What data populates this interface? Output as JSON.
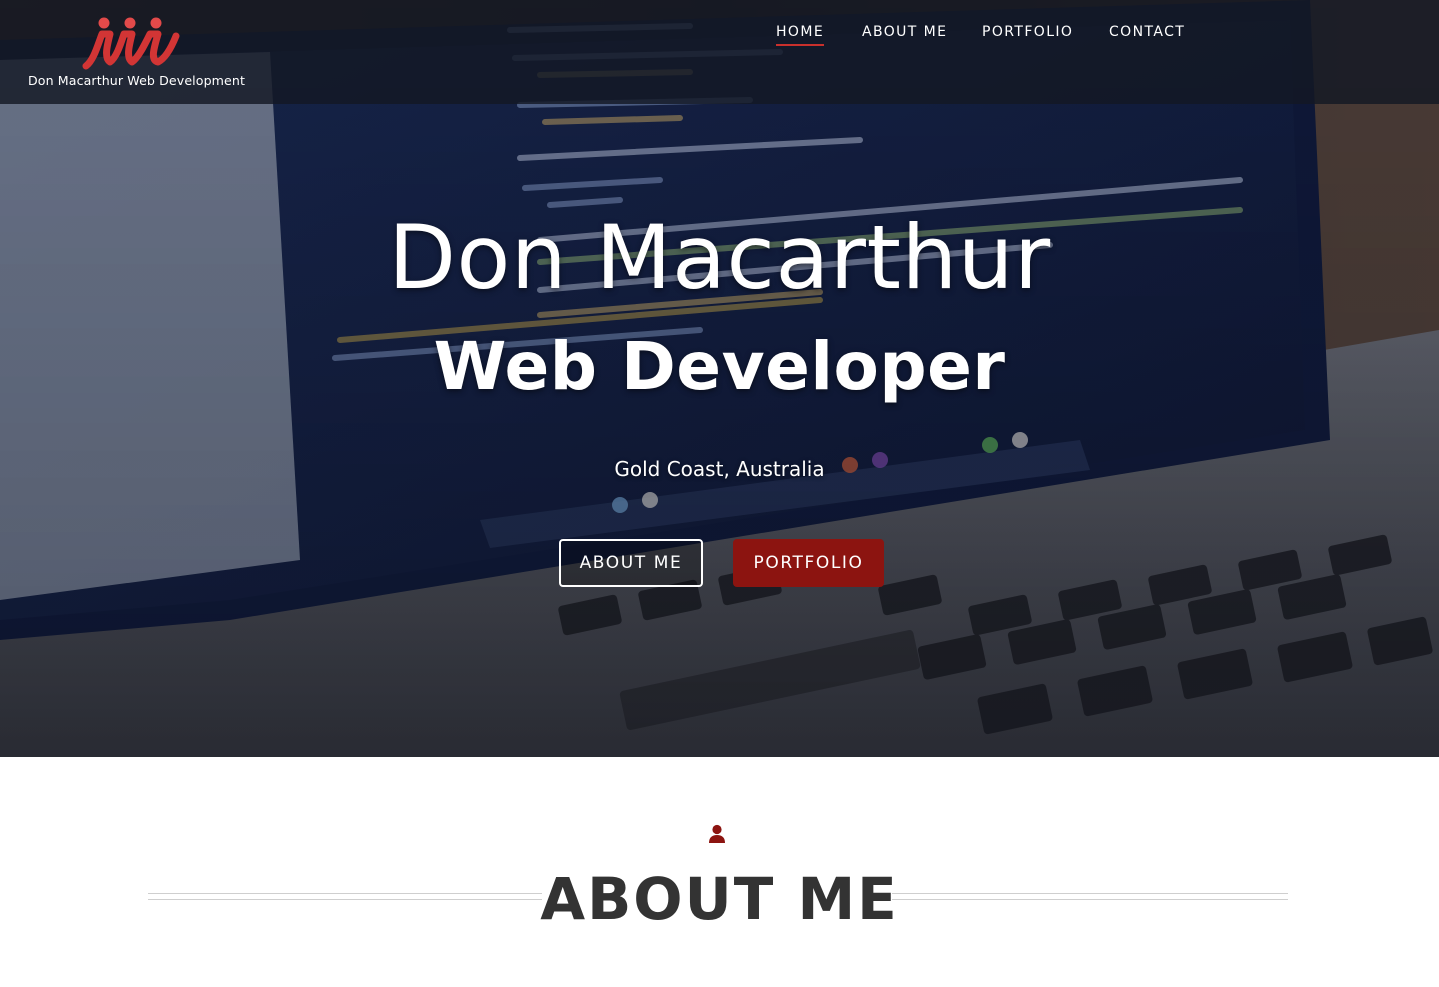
{
  "brand": {
    "logo_icon": "mw-monogram-logo",
    "name": "Don Macarthur Web Development",
    "accent_color": "#c9302c"
  },
  "nav": {
    "items": [
      {
        "label": "HOME",
        "active": true
      },
      {
        "label": "ABOUT ME",
        "active": false
      },
      {
        "label": "PORTFOLIO",
        "active": false
      },
      {
        "label": "CONTACT",
        "active": false
      }
    ]
  },
  "hero": {
    "background": "laptop-code-photo",
    "title": "Don Macarthur",
    "subtitle": "Web Developer",
    "location": "Gold Coast, Australia",
    "buttons": {
      "about_label": "ABOUT ME",
      "portfolio_label": "PORTFOLIO",
      "portfolio_color": "#8c1410"
    }
  },
  "about": {
    "icon": "user-icon",
    "icon_color": "#8c1410",
    "heading": "ABOUT ME"
  }
}
